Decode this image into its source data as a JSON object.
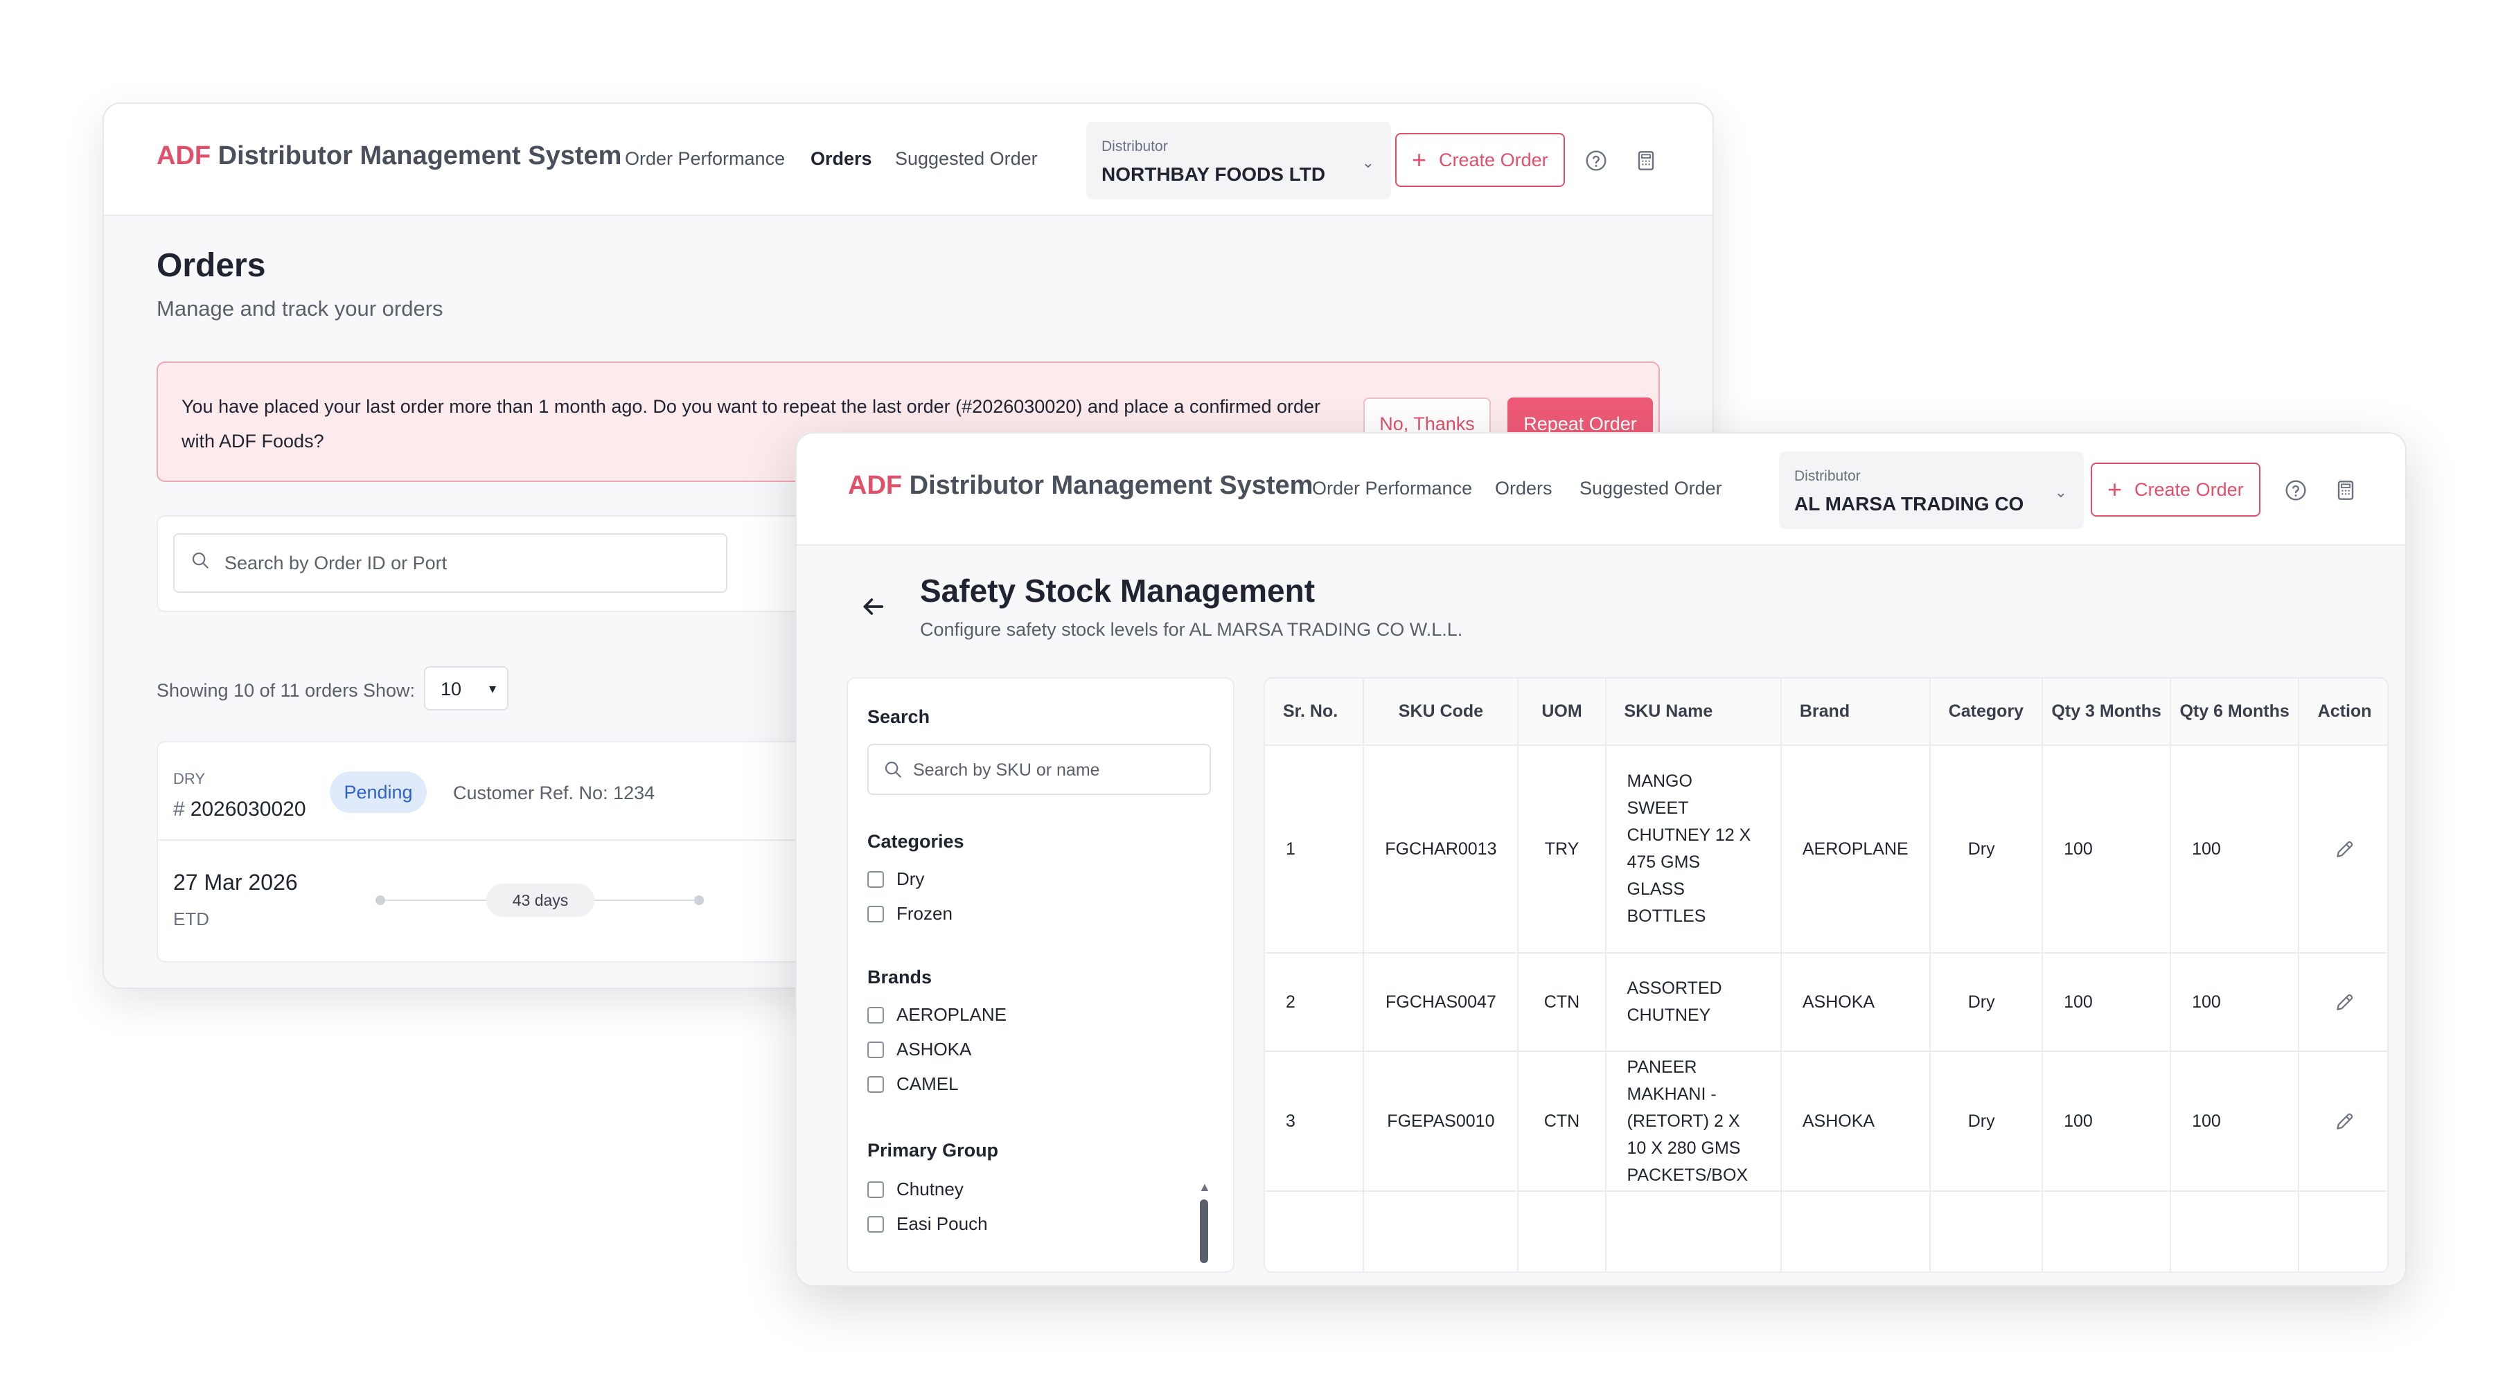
{
  "colors": {
    "accent": "#e0506a",
    "alert_bg": "#fdeaed",
    "pending_bg": "#dfeafb",
    "pending_text": "#2d63c8"
  },
  "orders_window": {
    "brand_accent": "ADF",
    "brand_rest": "Distributor Management System",
    "nav": [
      "Order Performance",
      "Orders",
      "Suggested Order"
    ],
    "distributor_label": "Distributor",
    "distributor_value": "NORTHBAY FOODS LTD",
    "create_order": "Create Order",
    "title": "Orders",
    "subtitle": "Manage and track your orders",
    "alert_message": "You have placed your last order more than 1 month ago. Do you want to repeat the last order (#2026030020) and place a confirmed order with ADF Foods?",
    "no_thanks": "No, Thanks",
    "repeat_order": "Repeat Order",
    "search_placeholder": "Search by Order ID or Port",
    "showing": "Showing 10 of 11 orders",
    "show_label": "Show:",
    "show_value": "10",
    "order": {
      "type": "DRY",
      "hash": "#",
      "id": "2026030020",
      "status": "Pending",
      "customer_ref": "Customer Ref. No: 1234",
      "date": "27 Mar 2026",
      "date_label": "ETD",
      "days": "43 days",
      "truncated_date_char": "("
    }
  },
  "safety_window": {
    "brand_accent": "ADF",
    "brand_rest": "Distributor Management System",
    "nav": [
      "Order Performance",
      "Orders",
      "Suggested Order"
    ],
    "distributor_label": "Distributor",
    "distributor_value": "AL MARSA TRADING CO",
    "create_order": "Create Order",
    "title": "Safety Stock Management",
    "subtitle": "Configure safety stock levels for AL MARSA TRADING CO W.L.L.",
    "filters": {
      "search_heading": "Search",
      "search_placeholder": "Search by SKU or name",
      "categories_heading": "Categories",
      "categories": [
        "Dry",
        "Frozen"
      ],
      "brands_heading": "Brands",
      "brands": [
        "AEROPLANE",
        "ASHOKA",
        "CAMEL"
      ],
      "primary_group_heading": "Primary Group",
      "primary_groups": [
        "Chutney",
        "Easi Pouch"
      ]
    },
    "table": {
      "headers": [
        "Sr. No.",
        "SKU Code",
        "UOM",
        "SKU Name",
        "Brand",
        "Category",
        "Qty 3 Months",
        "Qty 6 Months",
        "Action"
      ],
      "rows": [
        {
          "sr": "1",
          "sku": "FGCHAR0013",
          "uom": "TRY",
          "name_lines": [
            "MANGO",
            "SWEET",
            "CHUTNEY 12 X",
            "475 GMS",
            "GLASS",
            "BOTTLES"
          ],
          "brand": "AEROPLANE",
          "category": "Dry",
          "qty3": "100",
          "qty6": "100"
        },
        {
          "sr": "2",
          "sku": "FGCHAS0047",
          "uom": "CTN",
          "name_lines": [
            "ASSORTED",
            "CHUTNEY"
          ],
          "brand": "ASHOKA",
          "category": "Dry",
          "qty3": "100",
          "qty6": "100"
        },
        {
          "sr": "3",
          "sku": "FGEPAS0010",
          "uom": "CTN",
          "name_lines": [
            "PANEER",
            "MAKHANI -",
            "(RETORT) 2 X",
            "10 X 280 GMS",
            "PACKETS/BOX"
          ],
          "brand": "ASHOKA",
          "category": "Dry",
          "qty3": "100",
          "qty6": "100"
        }
      ]
    }
  }
}
